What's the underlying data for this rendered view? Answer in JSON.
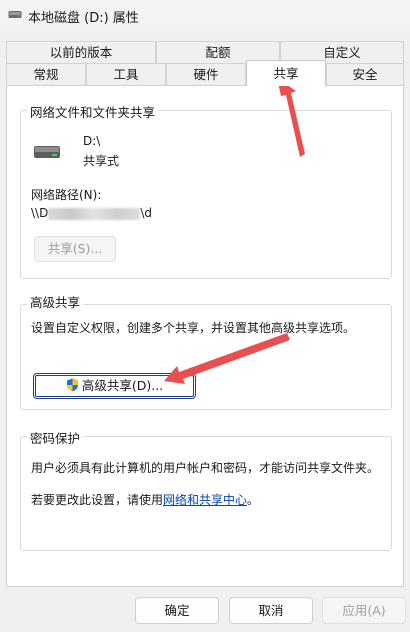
{
  "window": {
    "title": "本地磁盘 (D:) 属性"
  },
  "tabs": {
    "row1": [
      "以前的版本",
      "配额",
      "自定义"
    ],
    "row2": [
      "常规",
      "工具",
      "硬件",
      "共享",
      "安全"
    ],
    "active": "共享"
  },
  "network_share": {
    "group_title": "网络文件和文件夹共享",
    "drive_label": "D:\\",
    "drive_status": "共享式",
    "path_label": "网络路径(N):",
    "path_value_start": "\\\\D",
    "path_value_end": "\\d",
    "share_button": "共享(S)..."
  },
  "advanced_share": {
    "group_title": "高级共享",
    "description": "设置自定义权限，创建多个共享，并设置其他高级共享选项。",
    "button": "高级共享(D)..."
  },
  "password": {
    "group_title": "密码保护",
    "description": "用户必须具有此计算机的用户帐户和密码，才能访问共享文件夹。",
    "change_prefix": "若要更改此设置，请使用",
    "link": "网络和共享中心",
    "change_suffix": "。"
  },
  "footer": {
    "ok": "确定",
    "cancel": "取消",
    "apply": "应用(A)"
  },
  "colors": {
    "annotation_arrow": "#e8504f",
    "link": "#0645ad"
  }
}
